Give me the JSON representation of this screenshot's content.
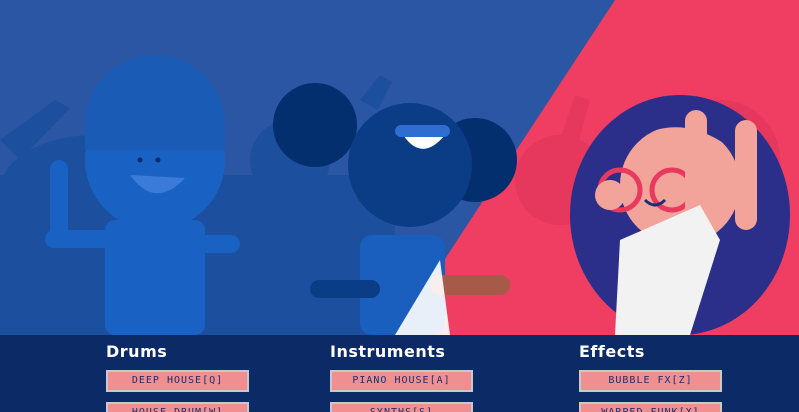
{
  "sections": [
    {
      "title": "Drums",
      "pads": [
        "DEEP HOUSE[Q]",
        "HOUSE DRUM[W]"
      ]
    },
    {
      "title": "Instruments",
      "pads": [
        "PIANO HOUSE[A]",
        "SYNTHS[S]"
      ]
    },
    {
      "title": "Effects",
      "pads": [
        "BUBBLE FX[Z]",
        "WARPED FUNK[X]"
      ]
    }
  ],
  "colors": {
    "blue_bg": "#2a56a4",
    "pink_bg": "#f03d62",
    "panel_bg": "#0b2a66",
    "pad_bg": "#f08f8f",
    "pad_text": "#1b2f74"
  }
}
